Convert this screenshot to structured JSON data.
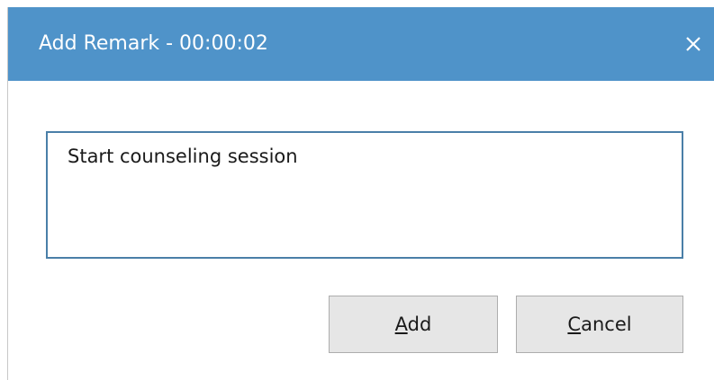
{
  "dialog": {
    "title": "Add Remark - 00:00:02",
    "close_icon": "close-icon"
  },
  "remark": {
    "value": "Start counseling session"
  },
  "buttons": {
    "add": {
      "mnemonic": "A",
      "rest": "dd"
    },
    "cancel": {
      "mnemonic": "C",
      "rest": "ancel"
    }
  },
  "colors": {
    "titlebar": "#4f93c9",
    "input_border": "#4a7fa8",
    "button_bg": "#e6e6e6"
  }
}
